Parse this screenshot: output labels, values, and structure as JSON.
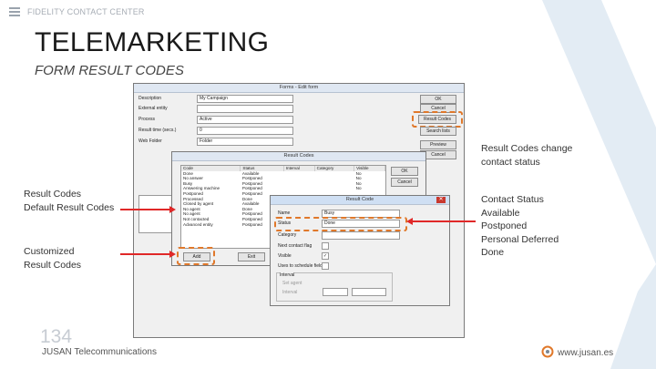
{
  "header": {
    "brand": "FIDELITY CONTACT CENTER",
    "title": "TELEMARKETING",
    "subtitle": "FORM RESULT CODES"
  },
  "annotations": {
    "right_top": [
      "Result Codes change",
      "contact status"
    ],
    "right_list_title": "Contact Status",
    "right_list": [
      "Available",
      "Postponed",
      "Personal Deferred",
      "Done"
    ],
    "left_top": [
      "Result Codes",
      "Default Result Codes"
    ],
    "left_bottom": [
      "Customized",
      "Result Codes"
    ]
  },
  "form_window": {
    "title": "Forms - Edit form",
    "labels": [
      "Description",
      "External entity",
      "Process",
      "Result time (secs.)",
      "Web Folder"
    ],
    "values": [
      "My Campaign",
      "",
      "Active",
      "0",
      "Folder"
    ],
    "buttons": [
      "OK",
      "Cancel",
      "Result Codes",
      "Search lists",
      "Preview",
      "Cancel"
    ]
  },
  "result_codes_window": {
    "title": "Result Codes",
    "headers": [
      "Code",
      "Status",
      "Interval",
      "Category",
      "Visible"
    ],
    "rows": [
      [
        "Done",
        "Available",
        "",
        "",
        "No"
      ],
      [
        "No answer",
        "Postponed",
        "",
        "",
        "No"
      ],
      [
        "Busy",
        "Postponed",
        "",
        "",
        "No"
      ],
      [
        "Answering machine",
        "Postponed",
        "",
        "",
        "No"
      ],
      [
        "Postponed",
        "Postponed",
        "",
        "",
        ""
      ],
      [
        "Processed",
        "Done",
        "",
        "",
        ""
      ],
      [
        "Closed by agent",
        "Available",
        "",
        "",
        ""
      ],
      [
        "No agent",
        "Done",
        "",
        "",
        ""
      ],
      [
        "No agent",
        "Postponed",
        "",
        "",
        ""
      ],
      [
        "Not contacted",
        "Postponed",
        "",
        "",
        ""
      ],
      [
        "Advanced entity",
        "Postponed",
        "",
        "",
        ""
      ]
    ],
    "buttons": [
      "OK",
      "Cancel",
      "Add",
      "Exit"
    ]
  },
  "result_code_dialog": {
    "title": "Result Code",
    "name_label": "Name",
    "name_value": "Busy",
    "status_label": "Status",
    "status_value": "Done",
    "category_label": "Category",
    "checks": [
      "Next contact flag",
      "Visible",
      "Uses to schedule fields"
    ],
    "interval_label": "Interval",
    "interval_opts": [
      "Set agent",
      "Interval"
    ]
  },
  "footer": {
    "page": "134",
    "company": "JUSAN Telecommunications",
    "url": "www.jusan.es"
  },
  "colors": {
    "accent": "#e0782a",
    "arrow": "#e02828",
    "stripe": "#d5e3ef"
  }
}
